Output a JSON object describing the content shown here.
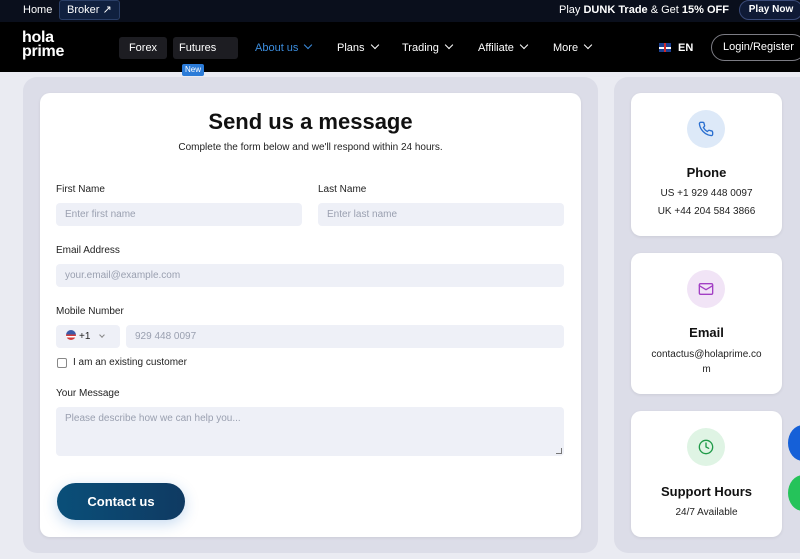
{
  "topbar": {
    "home": "Home",
    "broker": "Broker ↗",
    "promo_prefix": "Play ",
    "promo_game": "DUNK Trade",
    "promo_mid": " & Get ",
    "promo_off": "15% OFF",
    "play_now": "Play Now"
  },
  "nav": {
    "logo_line1": "hola",
    "logo_line2": "prime",
    "forex": "Forex",
    "futures": "Futures",
    "futures_badge": "New",
    "items": [
      "About us",
      "Plans",
      "Trading",
      "Affiliate",
      "More"
    ],
    "language": "EN",
    "login": "Login/Register"
  },
  "form": {
    "title": "Send us a message",
    "subtitle": "Complete the form below and we'll respond within 24 hours.",
    "first_name_label": "First Name",
    "first_name_placeholder": "Enter first name",
    "last_name_label": "Last Name",
    "last_name_placeholder": "Enter last name",
    "email_label": "Email Address",
    "email_placeholder": "your.email@example.com",
    "mobile_label": "Mobile Number",
    "country_code": "+1",
    "mobile_placeholder": "929 448 0097",
    "existing_customer": "I am an existing customer",
    "message_label": "Your Message",
    "message_placeholder": "Please describe how we can help you...",
    "submit": "Contact us"
  },
  "cards": {
    "phone": {
      "title": "Phone",
      "line1": "US +1 929 448 0097",
      "line2": "UK +44 204 584 3866",
      "icon": "phone-icon"
    },
    "email": {
      "title": "Email",
      "line1": "contactus@holaprime.co",
      "line2": "m",
      "icon": "mail-icon"
    },
    "hours": {
      "title": "Support Hours",
      "line1": "24/7 Available",
      "icon": "clock-icon"
    }
  },
  "colors": {
    "accent_blue": "#3c8dde",
    "button": "#0a4f79",
    "phone_bg": "#dde9f8",
    "email_bg": "#f1e4f6",
    "hours_bg": "#dff4e4"
  }
}
